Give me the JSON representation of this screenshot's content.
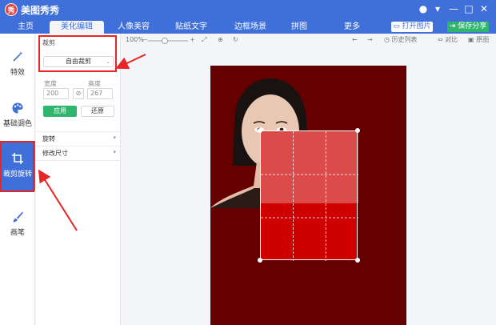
{
  "app": {
    "title": "美图秀秀",
    "logo_glyph": "秀"
  },
  "window_controls": {
    "chat": "●",
    "menu": "▾",
    "minimize": "—",
    "maximize": "□",
    "close": "✕"
  },
  "tabs": [
    "主页",
    "美化编辑",
    "人像美容",
    "贴纸文字",
    "边框场景",
    "拼图",
    "更多"
  ],
  "active_tab": "美化编辑",
  "header_buttons": {
    "open": "打开图片",
    "save": "保存分享"
  },
  "sidebar": {
    "items": [
      {
        "label": "特效",
        "icon": "magic-wand-icon"
      },
      {
        "label": "基础调色",
        "icon": "palette-icon"
      },
      {
        "label": "裁剪旋转",
        "icon": "crop-icon"
      },
      {
        "label": "画笔",
        "icon": "brush-icon"
      }
    ],
    "active": "裁剪旋转"
  },
  "panel": {
    "crop_title": "裁剪",
    "crop_mode": "自由裁剪",
    "width_label": "宽度",
    "height_label": "高度",
    "width_value": "200",
    "height_value": "267",
    "apply": "应用",
    "reset": "还原",
    "rotate": "旋转",
    "resize": "修改尺寸"
  },
  "editor_toolbar": {
    "zoom": "100%",
    "zoom_minus": "—",
    "zoom_plus": "+",
    "history": "历史列表",
    "compare": "对比",
    "original": "原图"
  },
  "colors": {
    "primary": "#3f6fd8",
    "green": "#2fb56e",
    "canvas_bg": "#650000",
    "crop_fill": "#cf0000",
    "annotation": "#ea2424"
  }
}
